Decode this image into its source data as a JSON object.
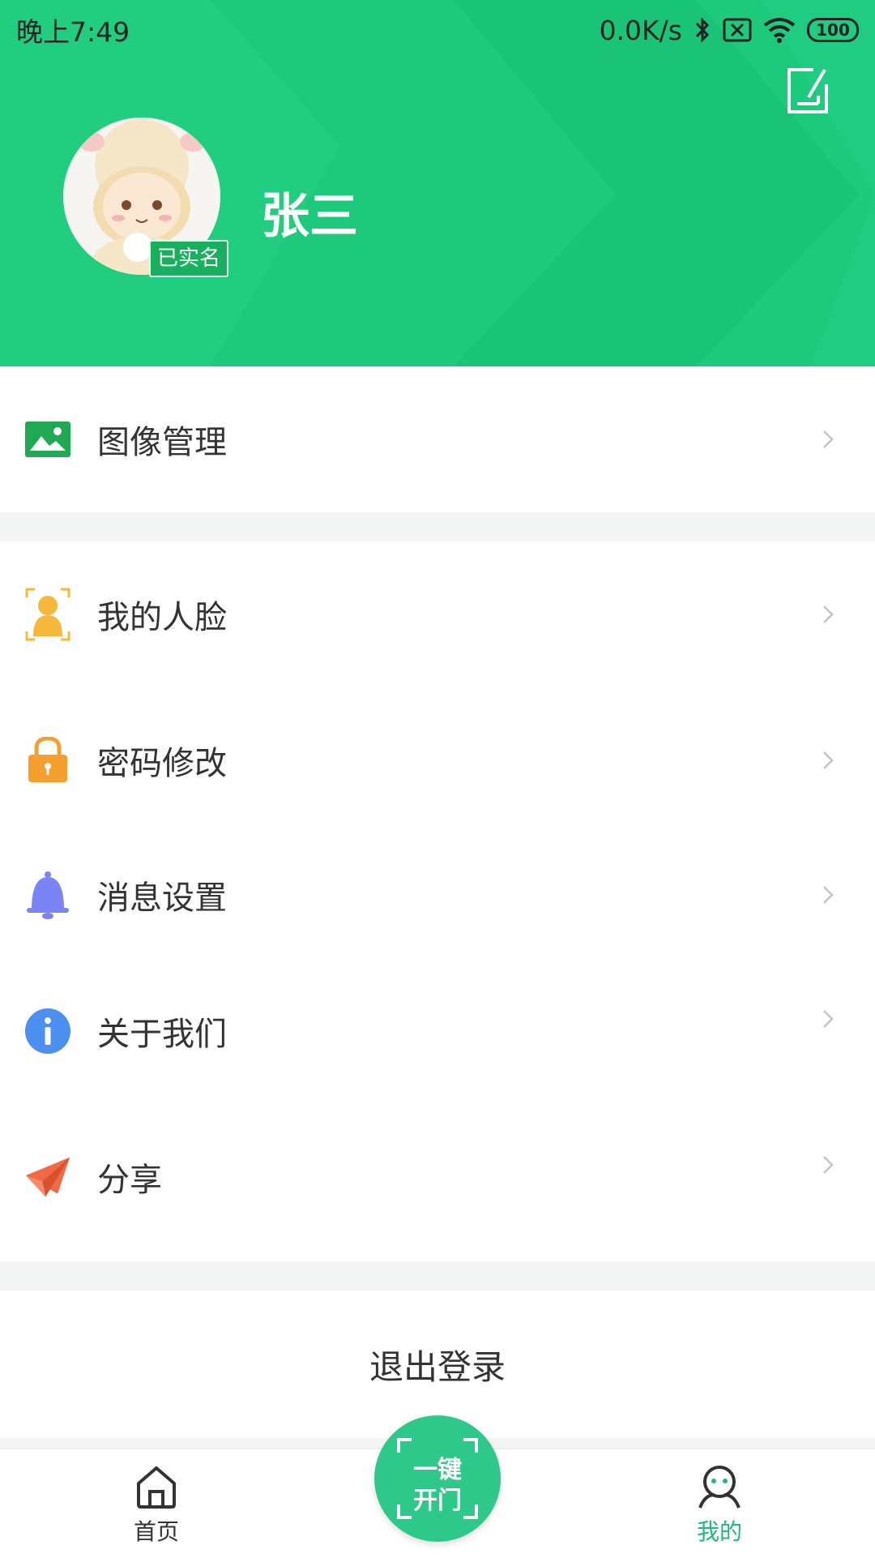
{
  "status_bar": {
    "time": "晚上7:49",
    "network_speed": "0.0K/s",
    "battery": "100"
  },
  "profile": {
    "name": "张三",
    "verified_badge": "已实名"
  },
  "menu_group_1": [
    {
      "label": "图像管理",
      "icon": "image-icon"
    }
  ],
  "menu_group_2": [
    {
      "label": "我的人脸",
      "icon": "face-icon"
    },
    {
      "label": "密码修改",
      "icon": "lock-icon"
    },
    {
      "label": "消息设置",
      "icon": "bell-icon"
    },
    {
      "label": "关于我们",
      "icon": "info-icon"
    },
    {
      "label": "分享",
      "icon": "paper-plane-icon"
    }
  ],
  "logout_label": "退出登录",
  "bottom_nav": {
    "home": "首页",
    "open_door_line1": "一键",
    "open_door_line2": "开门",
    "mine": "我的"
  },
  "colors": {
    "header_green": "#1dc97b",
    "active_nav": "#1dbb7a"
  }
}
